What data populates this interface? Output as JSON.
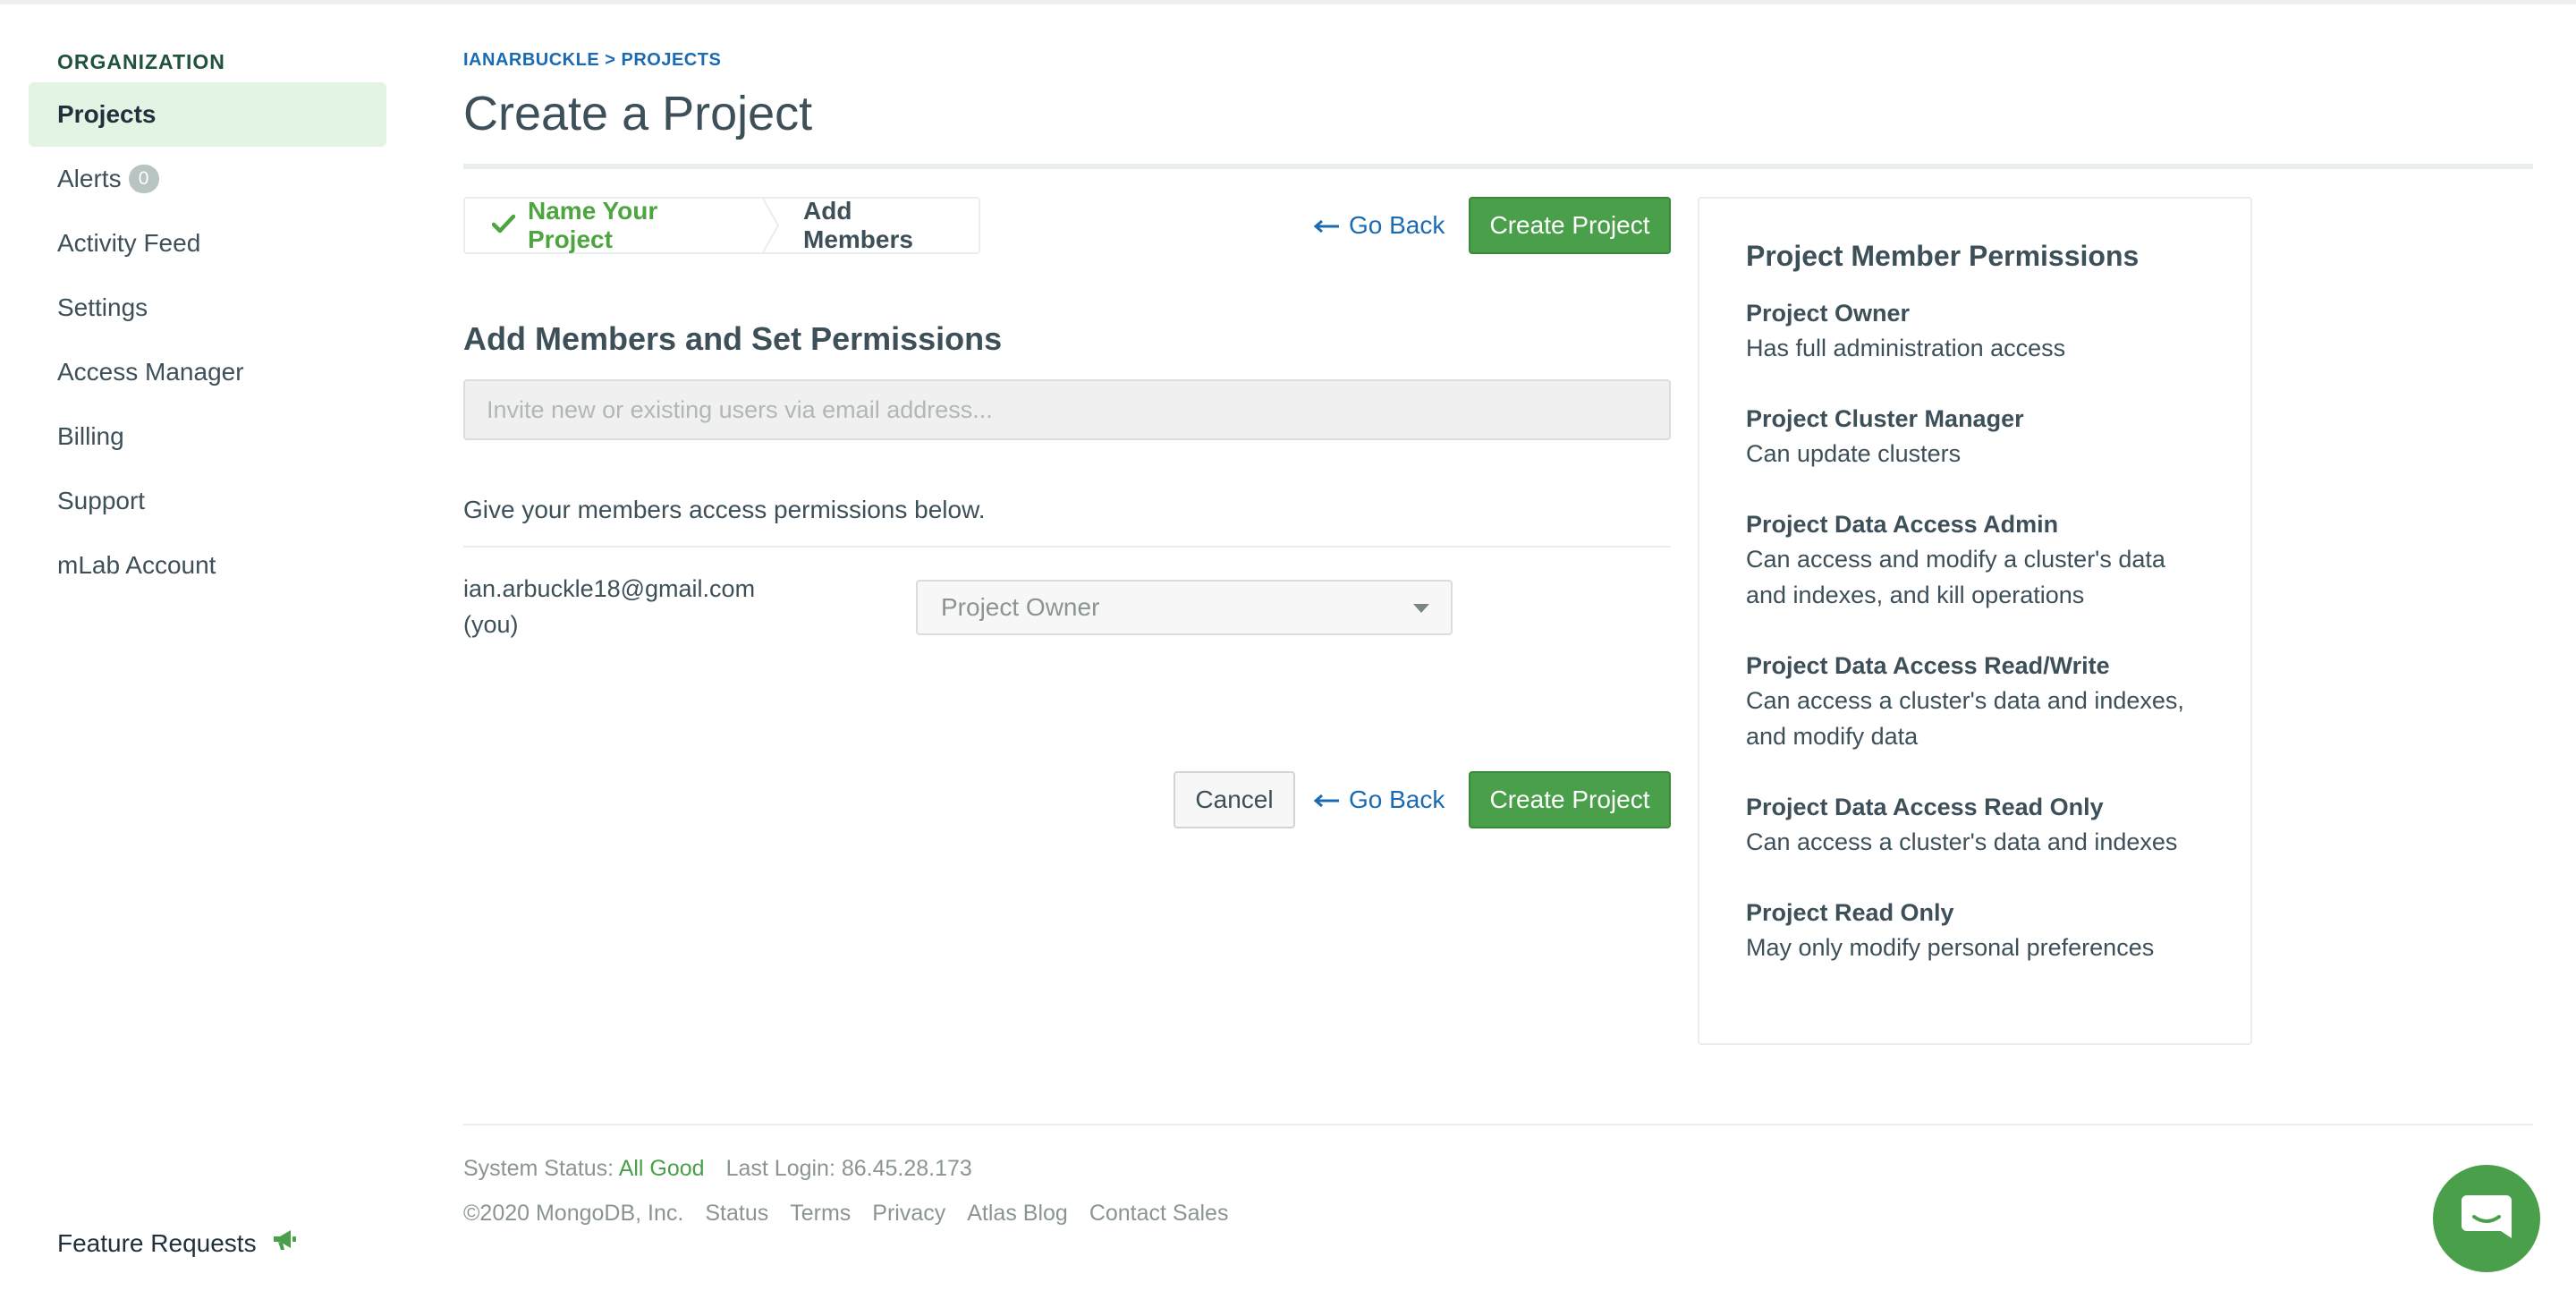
{
  "sidebar": {
    "section_label": "ORGANIZATION",
    "items": [
      {
        "label": "Projects",
        "active": true
      },
      {
        "label": "Alerts",
        "badge": "0"
      },
      {
        "label": "Activity Feed"
      },
      {
        "label": "Settings"
      },
      {
        "label": "Access Manager"
      },
      {
        "label": "Billing"
      },
      {
        "label": "Support"
      },
      {
        "label": "mLab Account"
      }
    ],
    "feature_requests": "Feature Requests"
  },
  "header": {
    "breadcrumb_org": "IANARBUCKLE",
    "breadcrumb_sep": ">",
    "breadcrumb_page": "PROJECTS",
    "title": "Create a Project"
  },
  "steps": {
    "step1": "Name Your Project",
    "step2": "Add Members"
  },
  "actions": {
    "go_back": "Go Back",
    "create_project": "Create Project",
    "cancel": "Cancel"
  },
  "form": {
    "section_title": "Add Members and Set Permissions",
    "invite_placeholder": "Invite new or existing users via email address...",
    "permissions_help": "Give your members access permissions below.",
    "member_email": "ian.arbuckle18@gmail.com",
    "member_you": "(you)",
    "member_role": "Project Owner"
  },
  "permissions_panel": {
    "title": "Project Member Permissions",
    "roles": [
      {
        "name": "Project Owner",
        "desc": "Has full administration access"
      },
      {
        "name": "Project Cluster Manager",
        "desc": "Can update clusters"
      },
      {
        "name": "Project Data Access Admin",
        "desc": "Can access and modify a cluster's data and indexes, and kill operations"
      },
      {
        "name": "Project Data Access Read/Write",
        "desc": "Can access a cluster's data and indexes, and modify data"
      },
      {
        "name": "Project Data Access Read Only",
        "desc": "Can access a cluster's data and indexes"
      },
      {
        "name": "Project Read Only",
        "desc": "May only modify personal preferences"
      }
    ]
  },
  "footer": {
    "system_status_label": "System Status:",
    "system_status_value": "All Good",
    "last_login": "Last Login: 86.45.28.173",
    "copyright": "©2020 MongoDB, Inc.",
    "links": [
      "Status",
      "Terms",
      "Privacy",
      "Atlas Blog",
      "Contact Sales"
    ]
  },
  "colors": {
    "accent_green": "#4aa04a",
    "link_blue": "#1a6bb3",
    "active_nav_bg": "#e4f4e4"
  },
  "icons": [
    "check-icon",
    "arrow-left-icon",
    "megaphone-icon",
    "chat-icon",
    "chevron-down-icon"
  ]
}
